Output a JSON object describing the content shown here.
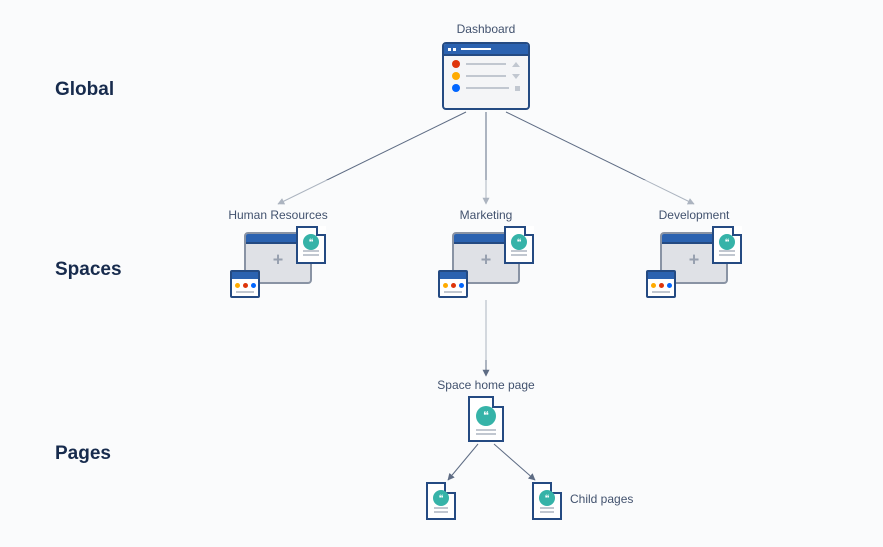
{
  "levels": {
    "global": "Global",
    "spaces": "Spaces",
    "pages": "Pages"
  },
  "nodes": {
    "dashboard": "Dashboard",
    "space1": "Human Resources",
    "space2": "Marketing",
    "space3": "Development",
    "space_home": "Space home page",
    "child": "Child pages"
  },
  "colors": {
    "red": "#de350b",
    "yellow": "#ffab00",
    "blue": "#0065ff",
    "teal": "#36b3a8",
    "orange": "#ff8b00"
  }
}
